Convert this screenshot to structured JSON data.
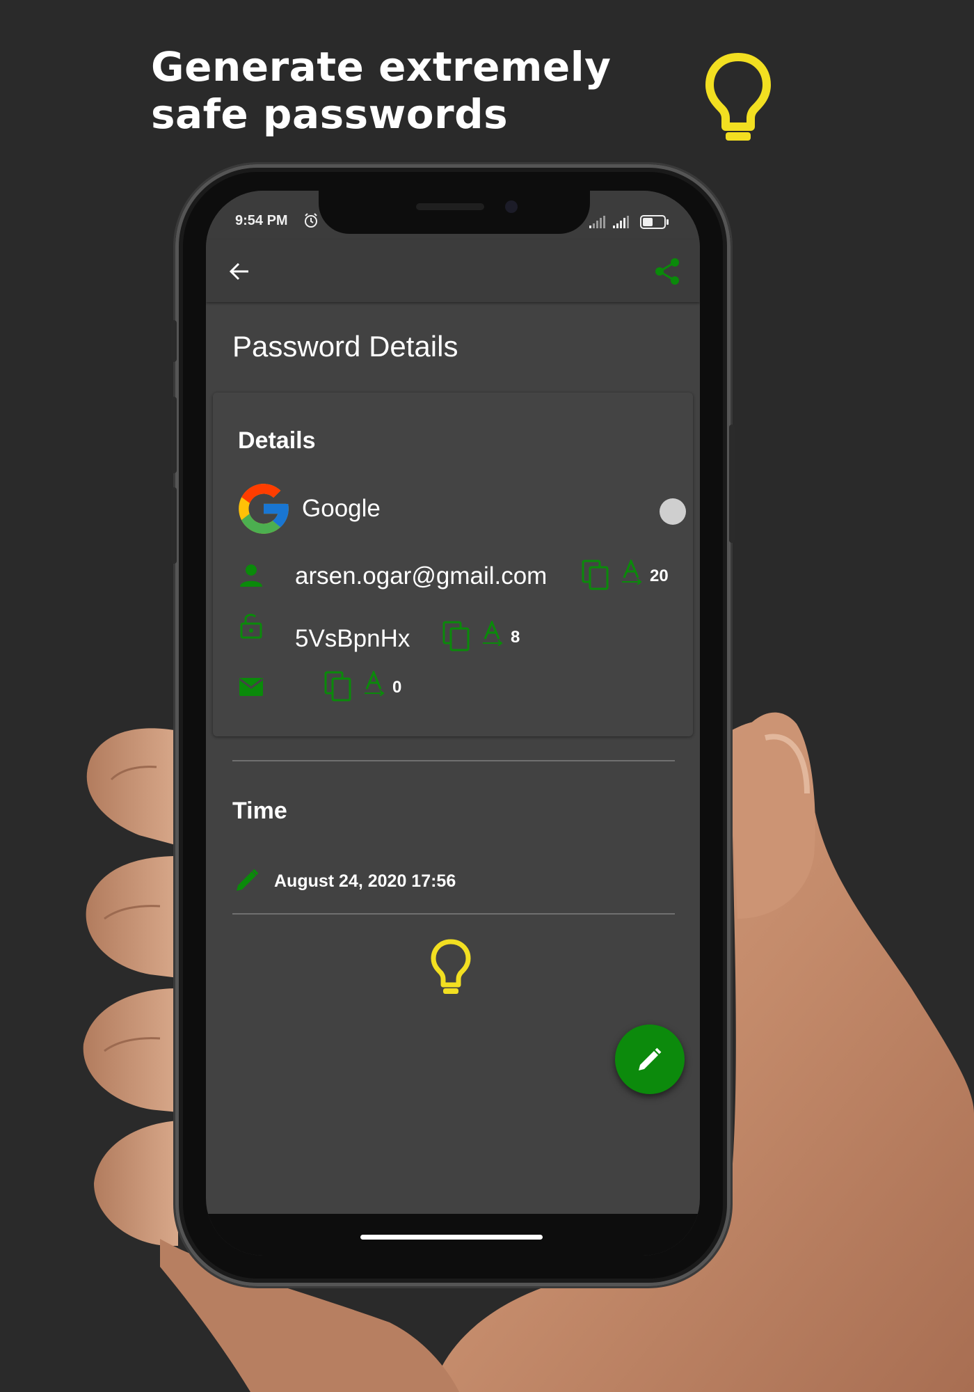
{
  "promo": {
    "headline": "Generate extremely safe passwords",
    "bulb_icon": "lightbulb-icon",
    "accent_color": "#F2DF21"
  },
  "status_bar": {
    "time": "9:54 PM",
    "icons": [
      "alarm-icon",
      "signal-icon",
      "signal-icon",
      "battery-icon"
    ]
  },
  "app_bar": {
    "back_icon": "arrow-back-icon",
    "share_icon": "share-icon"
  },
  "page": {
    "title": "Password Details"
  },
  "details": {
    "section_title": "Details",
    "site": {
      "name": "Google",
      "logo": "google-logo"
    },
    "username": {
      "value": "arsen.ogar@gmail.com",
      "length": "20"
    },
    "password": {
      "value": "5VsBpnHx",
      "length": "8"
    },
    "email": {
      "value": "",
      "length": "0"
    }
  },
  "time": {
    "section_title": "Time",
    "modified": "August 24, 2020 17:56"
  },
  "fab": {
    "icon": "edit-icon"
  },
  "colors": {
    "green": "#0A8A0A",
    "bulb_yellow": "#F2DF21",
    "screen_bg": "#424242"
  }
}
